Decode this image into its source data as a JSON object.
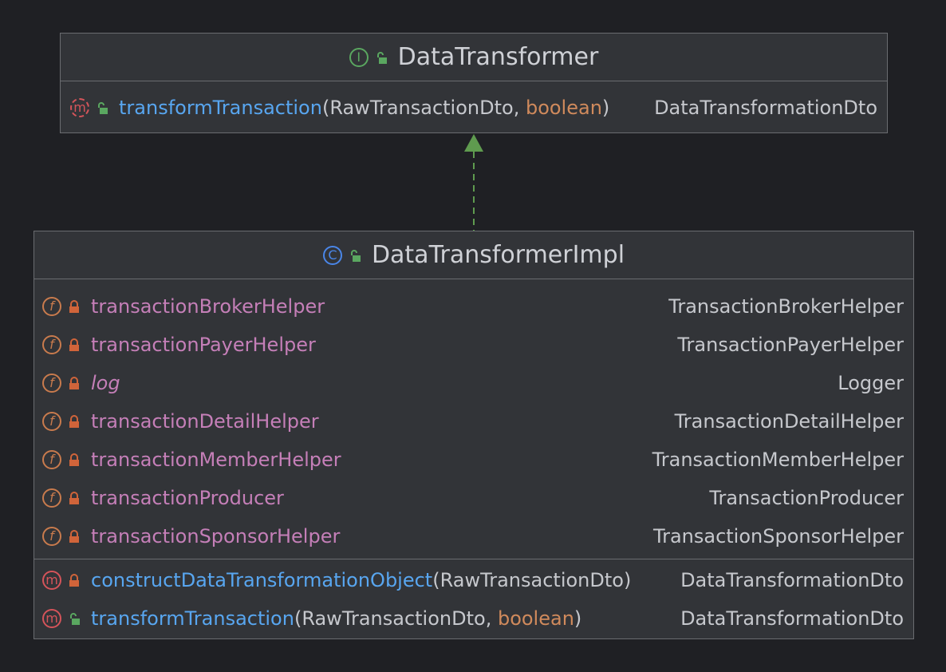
{
  "interface": {
    "name": "DataTransformer",
    "type_icon": "interface-icon",
    "access_icon": "public-lock-icon",
    "methods": [
      {
        "name": "transformTransaction",
        "params_open": "(",
        "param1": "RawTransactionDto",
        "comma": ", ",
        "param2": "boolean",
        "params_close": ")",
        "return_type": "DataTransformationDto",
        "visibility": "public",
        "icon": "abstract-method-icon"
      }
    ]
  },
  "relationship": {
    "type": "implements",
    "style": "dashed",
    "color": "#5f9b4f"
  },
  "class": {
    "name": "DataTransformerImpl",
    "type_icon": "class-icon",
    "access_icon": "public-lock-icon",
    "fields": [
      {
        "name": "transactionBrokerHelper",
        "type": "TransactionBrokerHelper",
        "visibility": "private",
        "italic": false
      },
      {
        "name": "transactionPayerHelper",
        "type": "TransactionPayerHelper",
        "visibility": "private",
        "italic": false
      },
      {
        "name": "log",
        "type": "Logger",
        "visibility": "private",
        "italic": true
      },
      {
        "name": "transactionDetailHelper",
        "type": "TransactionDetailHelper",
        "visibility": "private",
        "italic": false
      },
      {
        "name": "transactionMemberHelper",
        "type": "TransactionMemberHelper",
        "visibility": "private",
        "italic": false
      },
      {
        "name": "transactionProducer",
        "type": "TransactionProducer",
        "visibility": "private",
        "italic": false
      },
      {
        "name": "transactionSponsorHelper",
        "type": "TransactionSponsorHelper",
        "visibility": "private",
        "italic": false
      }
    ],
    "methods": [
      {
        "name": "constructDataTransformationObject",
        "params_open": "(",
        "param1": "RawTransactionDto",
        "params_close": ")",
        "return_type": "DataTransformationDto",
        "visibility": "private"
      },
      {
        "name": "transformTransaction",
        "params_open": "(",
        "param1": "RawTransactionDto",
        "comma": ", ",
        "param2": "boolean",
        "params_close": ")",
        "return_type": "DataTransformationDto",
        "visibility": "public"
      }
    ]
  },
  "icon_letters": {
    "method": "m",
    "field": "f",
    "interface": "I",
    "class": "C"
  },
  "colors": {
    "background": "#1f2024",
    "box": "#323438",
    "border": "#6a6c70",
    "field_name": "#c57fb8",
    "method_name": "#58a6f0",
    "keyword": "#d08a5c",
    "type": "#c6c8cd",
    "public_lock": "#5aa760",
    "private_lock": "#d0643a"
  }
}
